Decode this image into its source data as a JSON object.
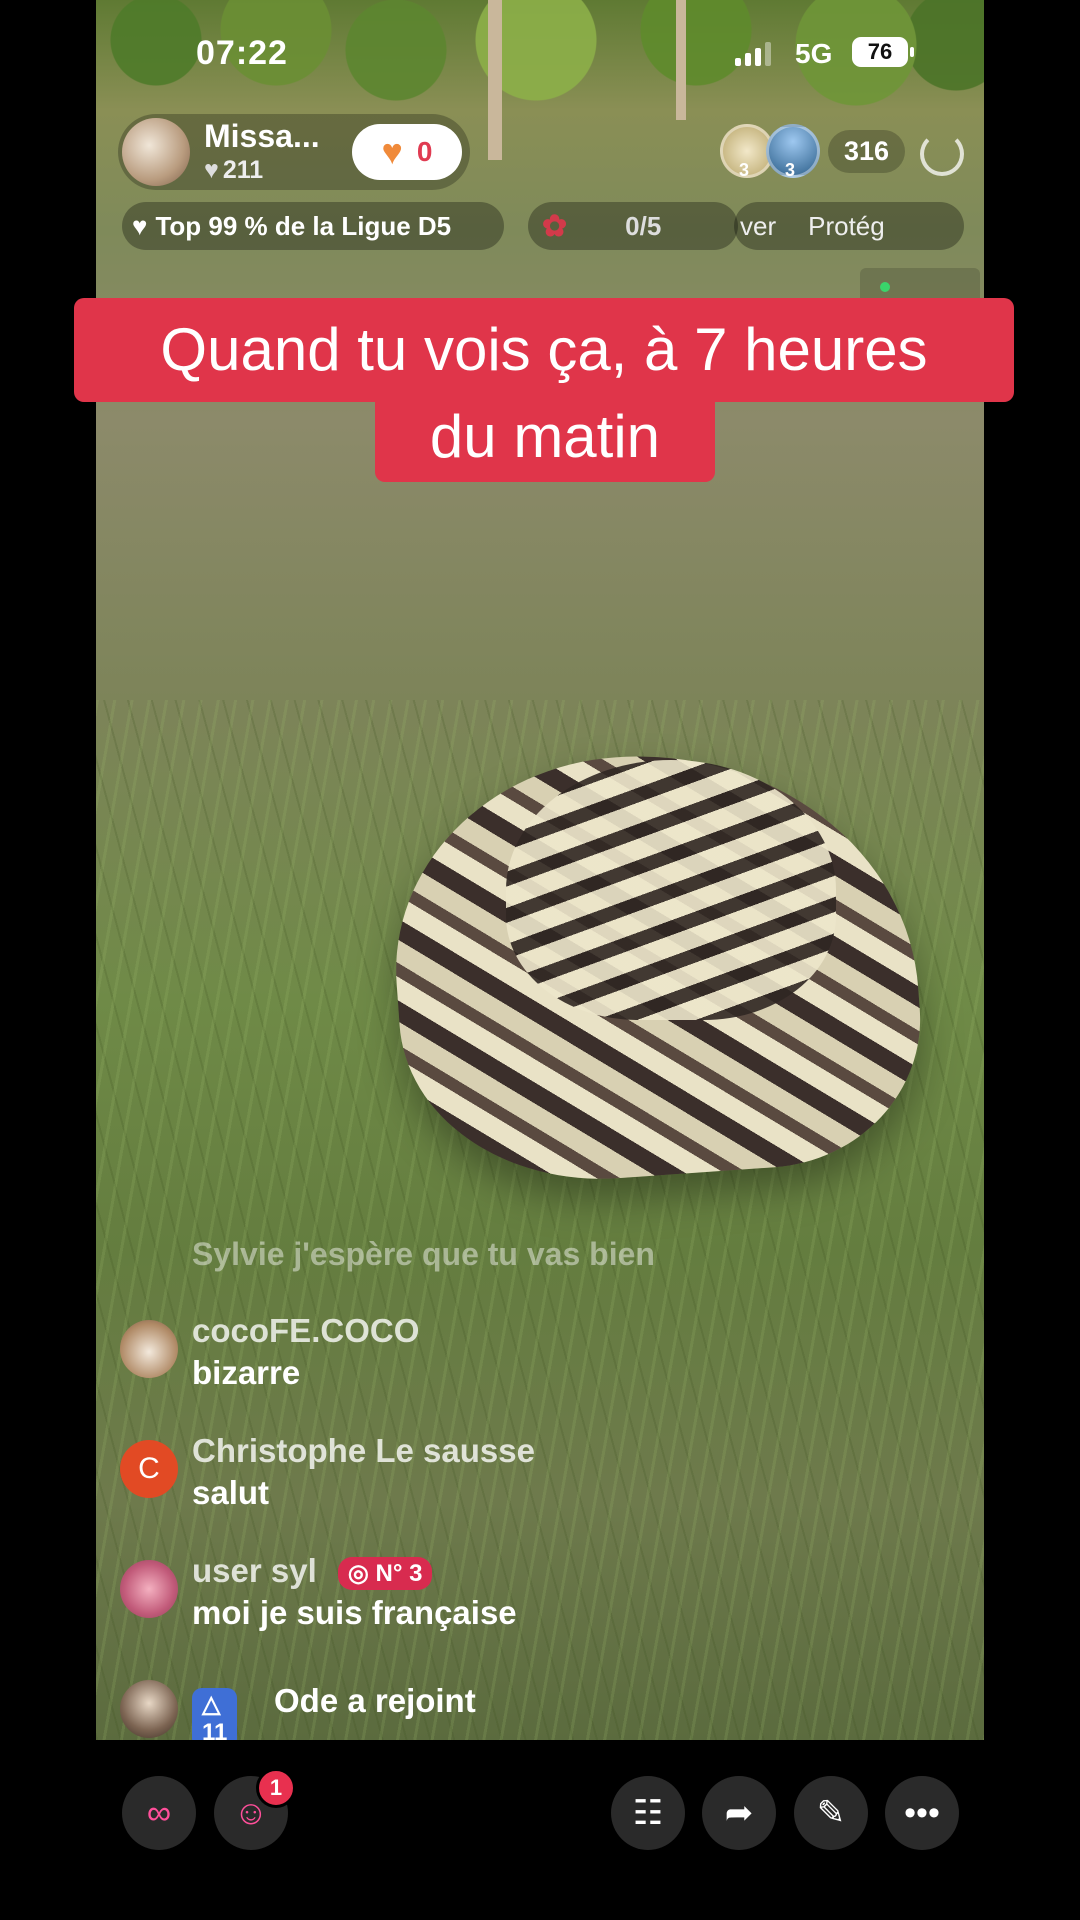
{
  "status_bar": {
    "time": "07:22",
    "network": "5G",
    "battery": "76"
  },
  "host": {
    "name": "Missa...",
    "likes": "211",
    "follow_count": "0"
  },
  "viewers": {
    "badge_a": "3",
    "badge_b": "3",
    "count": "316"
  },
  "league": {
    "label": "Top 99 % de la Ligue D5"
  },
  "gift_goal": {
    "progress": "0/5"
  },
  "marquee": {
    "text_a": "ver",
    "text_b": "Protég"
  },
  "caption": {
    "line1": "Quand tu vois ça, à 7 heures",
    "line2": "du matin"
  },
  "comments": {
    "faded": "Sylvie j'espère que tu vas bien",
    "items": [
      {
        "user": "cocoFE.COCO",
        "text": "bizarre"
      },
      {
        "user": "Christophe Le sausse",
        "avatar_letter": "C",
        "text": "salut"
      },
      {
        "user": "user syl",
        "badge": "N° 3",
        "text": "moi je suis française"
      }
    ],
    "joined": {
      "level": "11",
      "text": "Ode a rejoint"
    }
  },
  "bottom_bar": {
    "friends_notification": "1"
  },
  "colors": {
    "caption_bg": "#e0354a",
    "accent_pink": "#e8304f"
  }
}
